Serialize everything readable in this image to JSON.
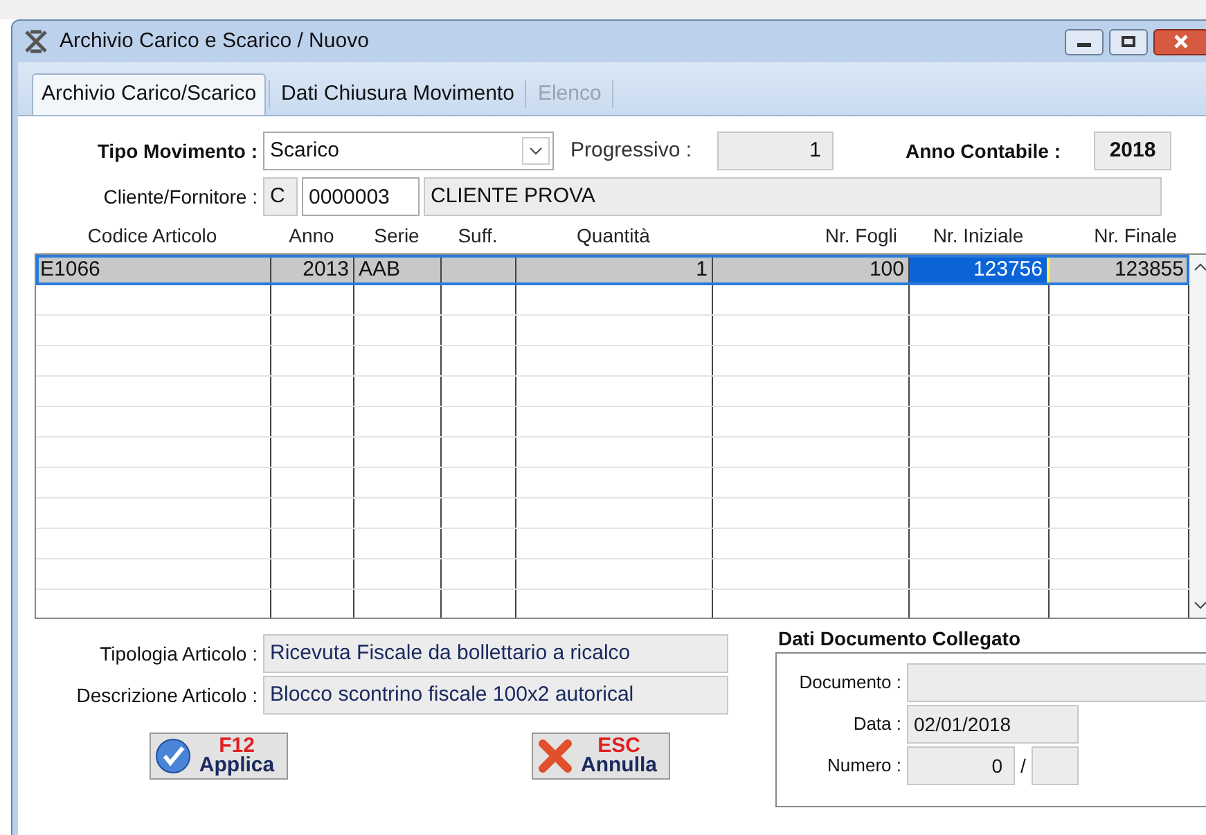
{
  "window": {
    "title": "Archivio Carico e Scarico / Nuovo"
  },
  "tabs": [
    {
      "label": "Archivio Carico/Scarico",
      "selected": true,
      "disabled": false
    },
    {
      "label": "Dati Chiusura Movimento",
      "selected": false,
      "disabled": false
    },
    {
      "label": "Elenco",
      "selected": false,
      "disabled": true
    }
  ],
  "tipo_movimento": {
    "label": "Tipo Movimento :",
    "value": "Scarico"
  },
  "progressivo": {
    "label": "Progressivo :",
    "value": "1"
  },
  "anno_contabile": {
    "label": "Anno Contabile :",
    "value": "2018"
  },
  "cliente_fornitore": {
    "label": "Cliente/Fornitore :",
    "type": "C",
    "code": "0000003",
    "name": "CLIENTE PROVA"
  },
  "table": {
    "columns": [
      "Codice Articolo",
      "Anno",
      "Serie",
      "Suff.",
      "Quantità",
      "Nr. Fogli",
      "Nr. Iniziale",
      "Nr. Finale"
    ],
    "rows": [
      {
        "selected": true,
        "cells": [
          {
            "text": "E1066",
            "focused": false
          },
          {
            "text": "2013",
            "focused": false
          },
          {
            "text": "AAB",
            "focused": false
          },
          {
            "text": "",
            "focused": false
          },
          {
            "text": "1",
            "focused": false
          },
          {
            "text": "100",
            "focused": false
          },
          {
            "text": "123756",
            "focused": true
          },
          {
            "text": "123855",
            "focused": false
          }
        ]
      }
    ]
  },
  "tipologia": {
    "label": "Tipologia Articolo :",
    "value": "Ricevuta Fiscale da bollettario a ricalco"
  },
  "descrizione": {
    "label": "Descrizione Articolo :",
    "value": "Blocco scontrino fiscale 100x2 autorical"
  },
  "documento_collegato": {
    "title": "Dati Documento Collegato",
    "documento": {
      "label": "Documento :"
    },
    "data": {
      "label": "Data :",
      "value": "02/01/2018"
    },
    "numero": {
      "label": "Numero :",
      "value": "0",
      "separator": "/"
    }
  },
  "buttons": [
    {
      "kind": "apply",
      "key": "F12",
      "label": "Applica"
    },
    {
      "kind": "cancel",
      "key": "ESC",
      "label": "Annulla"
    }
  ]
}
